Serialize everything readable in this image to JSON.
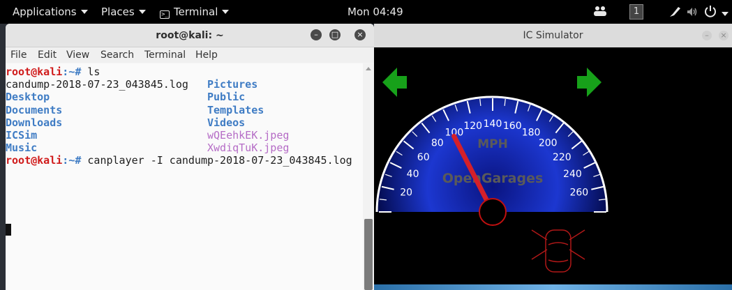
{
  "topbar": {
    "applications": "Applications",
    "places": "Places",
    "terminal": "Terminal",
    "clock": "Mon 04:49",
    "workspace": "1"
  },
  "terminal_window": {
    "title": "root@kali: ~",
    "menu": [
      "File",
      "Edit",
      "View",
      "Search",
      "Terminal",
      "Help"
    ],
    "prompt_user": "root@kali",
    "prompt_path": ":~#",
    "cmd1": " ls",
    "ls_left": [
      "candump-2018-07-23_043845.log",
      "Desktop",
      "Documents",
      "Downloads",
      "ICSim",
      "Music"
    ],
    "ls_right": [
      "Pictures",
      "Public",
      "Templates",
      "Videos",
      "wQEehkEK.jpeg",
      "XwdiqTuK.jpeg"
    ],
    "cmd2": " canplayer -I candump-2018-07-23_043845.log"
  },
  "ic_simulator": {
    "title": "IC Simulator",
    "unit_label": "MPH",
    "brand": "OpenGarages",
    "speed_ticks": [
      "20",
      "40",
      "60",
      "80",
      "100",
      "120",
      "140",
      "160",
      "180",
      "200",
      "220",
      "240",
      "260"
    ],
    "needle_speed": 98
  },
  "colors": {
    "prompt_red": "#d01b1b",
    "dir_blue": "#3f7cc4",
    "image_purple": "#b56cc6",
    "arrow_green": "#17a11a",
    "gauge_blue": "#1f3fd6"
  }
}
